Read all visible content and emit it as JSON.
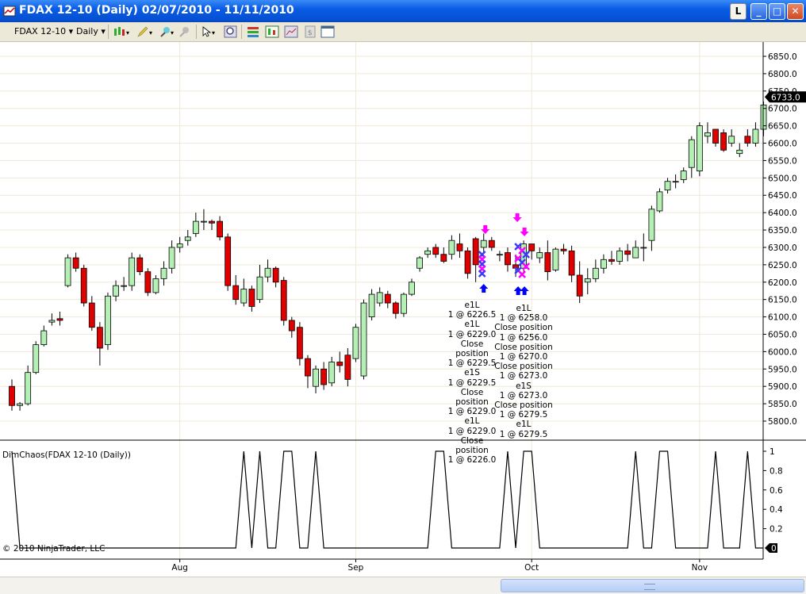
{
  "window": {
    "title": "FDAX 12-10 (Daily)  02/07/2010 - 11/11/2010",
    "buttons": {
      "l_label": "L",
      "minimize": "_",
      "maximize": "□",
      "close": "✕"
    }
  },
  "toolbar": {
    "instrument": "FDAX 12-10",
    "interval": "Daily",
    "icons": [
      "candlestick-style-icon",
      "pencil-drawing-icon",
      "add-indicator-icon",
      "remove-indicator-icon",
      "pointer-icon",
      "zoom-icon",
      "strategy-icon",
      "chart-properties-icon",
      "data-box-icon",
      "save-icon",
      "panel-icon"
    ]
  },
  "price_panel": {
    "current_price_label": "6733.0",
    "y_ticks": [
      "6850.0",
      "6800.0",
      "6750.0",
      "6700.0",
      "6650.0",
      "6600.0",
      "6550.0",
      "6500.0",
      "6450.0",
      "6400.0",
      "6350.0",
      "6300.0",
      "6250.0",
      "6200.0",
      "6150.0",
      "6100.0",
      "6050.0",
      "6000.0",
      "5950.0",
      "5900.0",
      "5850.0",
      "5800.0"
    ],
    "x_ticks": [
      "Aug",
      "Sep",
      "Oct",
      "Nov"
    ]
  },
  "trade_annotations": {
    "group_left": [
      "e1L",
      "1 @ 6226.5",
      "e1L",
      "1 @ 6229.0",
      "Close position",
      "1 @ 6229.5",
      "e1S",
      "1 @ 6229.5",
      "Close position",
      "1 @ 6229.0",
      "e1L",
      "1 @ 6229.0",
      "Close position",
      "1 @ 6226.0"
    ],
    "group_right": [
      "e1L",
      "1 @ 6258.0",
      "Close position",
      "1 @ 6256.0",
      "Close position",
      "1 @ 6270.0",
      "Close position",
      "1 @ 6273.0",
      "e1S",
      "1 @ 6273.0",
      "Close position",
      "1 @ 6279.5",
      "e1L",
      "1 @ 6279.5"
    ]
  },
  "indicator_panel": {
    "label": "DimChaos(FDAX 12-10 (Daily))",
    "y_ticks": [
      "1",
      "0.8",
      "0.6",
      "0.4",
      "0.2"
    ],
    "current_value_label": "0",
    "copyright": "© 2010 NinjaTrader, LLC"
  },
  "chart_data": {
    "type": "candlestick",
    "title": "FDAX 12-10 (Daily)  02/07/2010 - 11/11/2010",
    "ylim": [
      5770,
      6880
    ],
    "x": [
      "2010-07-02",
      "2010-07-05",
      "2010-07-06",
      "2010-07-07",
      "2010-07-08",
      "2010-07-09",
      "2010-07-12",
      "2010-07-13",
      "2010-07-14",
      "2010-07-15",
      "2010-07-16",
      "2010-07-19",
      "2010-07-20",
      "2010-07-21",
      "2010-07-22",
      "2010-07-23",
      "2010-07-26",
      "2010-07-27",
      "2010-07-28",
      "2010-07-29",
      "2010-07-30",
      "2010-08-02",
      "2010-08-03",
      "2010-08-04",
      "2010-08-05",
      "2010-08-06",
      "2010-08-09",
      "2010-08-10",
      "2010-08-11",
      "2010-08-12",
      "2010-08-13",
      "2010-08-16",
      "2010-08-17",
      "2010-08-18",
      "2010-08-19",
      "2010-08-20",
      "2010-08-23",
      "2010-08-24",
      "2010-08-25",
      "2010-08-26",
      "2010-08-27",
      "2010-08-30",
      "2010-08-31",
      "2010-09-01",
      "2010-09-02",
      "2010-09-03",
      "2010-09-06",
      "2010-09-07",
      "2010-09-08",
      "2010-09-09",
      "2010-09-10",
      "2010-09-13",
      "2010-09-14",
      "2010-09-15",
      "2010-09-16",
      "2010-09-17",
      "2010-09-20",
      "2010-09-21",
      "2010-09-22",
      "2010-09-23",
      "2010-09-24",
      "2010-09-27",
      "2010-09-28",
      "2010-09-29",
      "2010-09-30",
      "2010-10-01",
      "2010-10-04",
      "2010-10-05",
      "2010-10-06",
      "2010-10-07",
      "2010-10-08",
      "2010-10-11",
      "2010-10-12",
      "2010-10-13",
      "2010-10-14",
      "2010-10-15",
      "2010-10-18",
      "2010-10-19",
      "2010-10-20",
      "2010-10-21",
      "2010-10-22",
      "2010-10-25",
      "2010-10-26",
      "2010-10-27",
      "2010-10-28",
      "2010-10-29",
      "2010-11-01",
      "2010-11-02",
      "2010-11-03",
      "2010-11-04",
      "2010-11-05",
      "2010-11-08",
      "2010-11-09",
      "2010-11-10",
      "2010-11-11"
    ],
    "open": [
      5900,
      5845,
      5850,
      5940,
      6020,
      6085,
      6095,
      6190,
      6270,
      6240,
      6140,
      6070,
      6020,
      6160,
      6190,
      6190,
      6270,
      6230,
      6170,
      6210,
      6240,
      6300,
      6320,
      6340,
      6375,
      6375,
      6375,
      6330,
      6190,
      6140,
      6180,
      6150,
      6215,
      6240,
      6205,
      6090,
      6070,
      5980,
      5900,
      5950,
      5910,
      5970,
      5990,
      5980,
      5930,
      6100,
      6140,
      6165,
      6140,
      6110,
      6165,
      6240,
      6280,
      6300,
      6280,
      6280,
      6310,
      6290,
      6325,
      6300,
      6320,
      6280,
      6285,
      6250,
      6240,
      6310,
      6270,
      6285,
      6235,
      6295,
      6290,
      6220,
      6200,
      6210,
      6240,
      6265,
      6260,
      6290,
      6270,
      6300,
      6320,
      6405,
      6465,
      6490,
      6495,
      6530,
      6520,
      6620,
      6640,
      6630,
      6600,
      6570,
      6620,
      6600,
      6640
    ],
    "close": [
      5845,
      5850,
      5940,
      6020,
      6060,
      6090,
      6090,
      6270,
      6240,
      6140,
      6070,
      6010,
      6160,
      6190,
      6190,
      6270,
      6230,
      6170,
      6210,
      6240,
      6300,
      6310,
      6330,
      6375,
      6375,
      6370,
      6330,
      6190,
      6150,
      6180,
      6130,
      6215,
      6240,
      6200,
      6090,
      6060,
      5980,
      5930,
      5950,
      5905,
      5970,
      5960,
      5920,
      6070,
      6140,
      6165,
      6170,
      6140,
      6110,
      6165,
      6200,
      6270,
      6290,
      6280,
      6260,
      6320,
      6290,
      6225,
      6250,
      6320,
      6300,
      6280,
      6250,
      6240,
      6310,
      6290,
      6285,
      6230,
      6295,
      6290,
      6220,
      6160,
      6210,
      6240,
      6265,
      6260,
      6290,
      6280,
      6300,
      6300,
      6410,
      6460,
      6490,
      6490,
      6520,
      6610,
      6650,
      6630,
      6600,
      6580,
      6620,
      6580,
      6600,
      6640,
      6710
    ],
    "high": [
      5920,
      5855,
      5960,
      6030,
      6075,
      6110,
      6115,
      6280,
      6285,
      6250,
      6160,
      6085,
      6170,
      6205,
      6215,
      6285,
      6280,
      6240,
      6220,
      6260,
      6320,
      6330,
      6350,
      6400,
      6410,
      6380,
      6390,
      6340,
      6220,
      6210,
      6190,
      6250,
      6265,
      6245,
      6215,
      6100,
      6085,
      5990,
      5960,
      5970,
      5985,
      6000,
      6010,
      6080,
      6150,
      6180,
      6185,
      6175,
      6145,
      6170,
      6210,
      6275,
      6300,
      6310,
      6300,
      6335,
      6340,
      6300,
      6330,
      6340,
      6330,
      6290,
      6300,
      6280,
      6320,
      6300,
      6300,
      6320,
      6300,
      6310,
      6305,
      6260,
      6240,
      6265,
      6280,
      6290,
      6300,
      6310,
      6320,
      6340,
      6420,
      6470,
      6500,
      6510,
      6530,
      6620,
      6660,
      6660,
      6640,
      6640,
      6640,
      6600,
      6640,
      6660,
      6720
    ],
    "low": [
      5830,
      5830,
      5845,
      5935,
      6015,
      6075,
      6075,
      6185,
      6230,
      6130,
      6060,
      5960,
      6005,
      6145,
      6175,
      6175,
      6220,
      6160,
      6165,
      6190,
      6225,
      6285,
      6305,
      6330,
      6350,
      6350,
      6320,
      6175,
      6135,
      6130,
      6115,
      6140,
      6200,
      6185,
      6075,
      6040,
      5960,
      5895,
      5880,
      5890,
      5900,
      5940,
      5900,
      5970,
      5920,
      6090,
      6130,
      6125,
      6095,
      6100,
      6160,
      6230,
      6270,
      6270,
      6255,
      6265,
      6270,
      6210,
      6200,
      6285,
      6290,
      6260,
      6230,
      6215,
      6230,
      6265,
      6255,
      6205,
      6230,
      6280,
      6200,
      6140,
      6165,
      6200,
      6225,
      6250,
      6250,
      6260,
      6270,
      6260,
      6290,
      6400,
      6455,
      6470,
      6485,
      6500,
      6505,
      6600,
      6590,
      6575,
      6590,
      6560,
      6590,
      6590,
      6620
    ],
    "indicator": {
      "name": "DimChaos(FDAX 12-10 (Daily))",
      "ylim": [
        0,
        1
      ],
      "y_ticks": [
        0.2,
        0.4,
        0.6,
        0.8,
        1
      ],
      "peaks": [
        "2010-07-02",
        "2010-08-12",
        "2010-08-16",
        "2010-08-19",
        "2010-08-20",
        "2010-08-25",
        "2010-09-15",
        "2010-09-16",
        "2010-09-28",
        "2010-09-30",
        "2010-10-01",
        "2010-10-20",
        "2010-10-25",
        "2010-10-26",
        "2010-11-03",
        "2010-11-09"
      ]
    },
    "current_price": 6733.0,
    "current_indicator": 0
  }
}
